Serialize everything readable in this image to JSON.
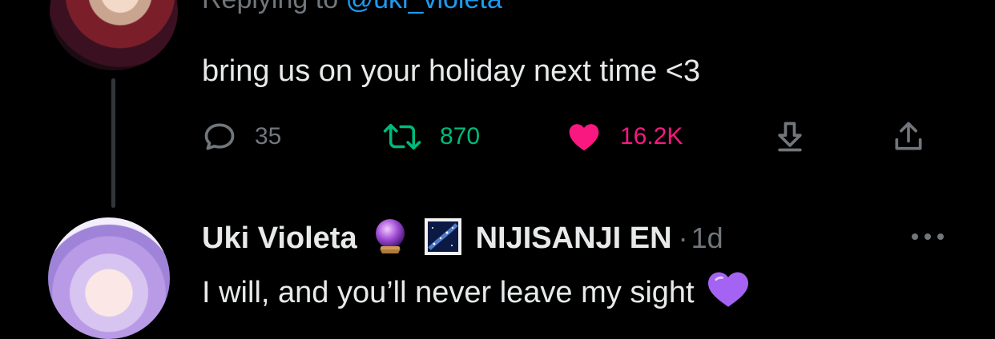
{
  "reply_tweet": {
    "replying_prefix": "Replying to",
    "replying_handle": "@uki_violeta",
    "text": "bring us on your holiday next time <3",
    "stats": {
      "replies": "35",
      "retweets": "870",
      "likes": "16.2K"
    },
    "icons": {
      "reply": "reply-icon",
      "retweet": "retweet-icon",
      "like": "heart-filled-icon",
      "bookmark": "bookmark-download-icon",
      "share": "share-icon"
    }
  },
  "quoted_reply": {
    "display_name": "Uki Violeta",
    "name_suffix": "NIJISANJI EN",
    "separator": "·",
    "timestamp": "1d",
    "text": "I will, and you’ll never leave my sight",
    "name_emojis": [
      "crystal-ball-emoji",
      "milky-way-emoji"
    ],
    "trailing_emoji": "purple-heart-emoji",
    "more_icon": "more-horizontal-icon"
  },
  "colors": {
    "background": "#000000",
    "text_primary": "#e7e9ea",
    "text_secondary": "#71767b",
    "link": "#1d9bf0",
    "retweet": "#00ba7c",
    "like": "#f91880",
    "thread_line": "#333639"
  }
}
